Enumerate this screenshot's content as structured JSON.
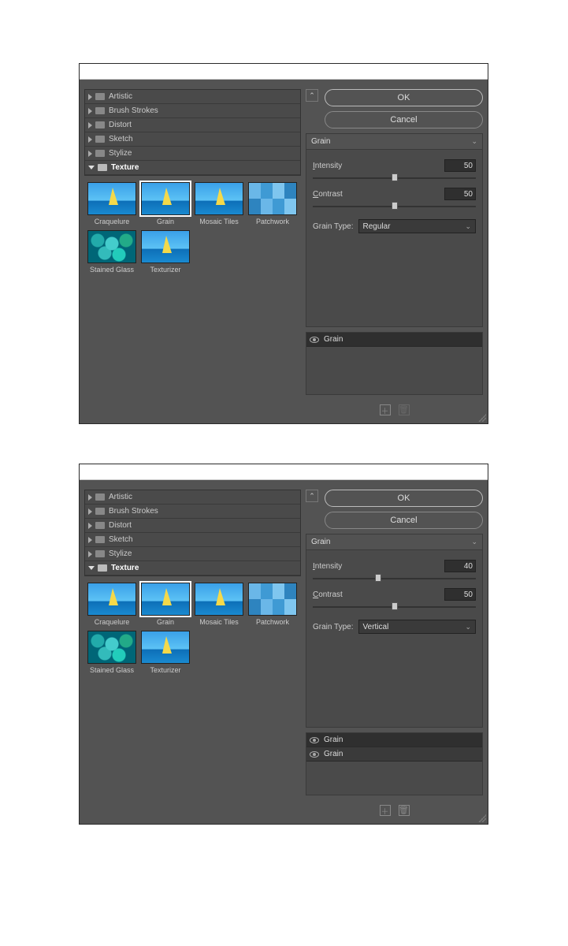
{
  "dialogs": [
    {
      "categories": [
        {
          "label": "Artistic",
          "expanded": false
        },
        {
          "label": "Brush Strokes",
          "expanded": false
        },
        {
          "label": "Distort",
          "expanded": false
        },
        {
          "label": "Sketch",
          "expanded": false
        },
        {
          "label": "Stylize",
          "expanded": false
        },
        {
          "label": "Texture",
          "expanded": true
        }
      ],
      "thumbs": [
        {
          "label": "Craquelure",
          "kind": "boat",
          "selected": false
        },
        {
          "label": "Grain",
          "kind": "boat",
          "selected": true
        },
        {
          "label": "Mosaic Tiles",
          "kind": "boat",
          "selected": false
        },
        {
          "label": "Patchwork",
          "kind": "patch",
          "selected": false
        },
        {
          "label": "Stained Glass",
          "kind": "glass",
          "selected": false
        },
        {
          "label": "Texturizer",
          "kind": "boat",
          "selected": false
        }
      ],
      "buttons": {
        "ok": "OK",
        "cancel": "Cancel"
      },
      "filterName": "Grain",
      "controls": {
        "intensity": {
          "label": "Intensity",
          "underline": "I",
          "value": "50",
          "pct": 50
        },
        "contrast": {
          "label": "Contrast",
          "underline": "C",
          "value": "50",
          "pct": 50
        },
        "grainType": {
          "label": "Grain Type:",
          "value": "Regular"
        }
      },
      "layers": [
        {
          "name": "Grain",
          "selected": true
        }
      ],
      "trashDisabled": true
    },
    {
      "categories": [
        {
          "label": "Artistic",
          "expanded": false
        },
        {
          "label": "Brush Strokes",
          "expanded": false
        },
        {
          "label": "Distort",
          "expanded": false
        },
        {
          "label": "Sketch",
          "expanded": false
        },
        {
          "label": "Stylize",
          "expanded": false
        },
        {
          "label": "Texture",
          "expanded": true
        }
      ],
      "thumbs": [
        {
          "label": "Craquelure",
          "kind": "boat",
          "selected": false
        },
        {
          "label": "Grain",
          "kind": "boat",
          "selected": true
        },
        {
          "label": "Mosaic Tiles",
          "kind": "boat",
          "selected": false
        },
        {
          "label": "Patchwork",
          "kind": "patch",
          "selected": false
        },
        {
          "label": "Stained Glass",
          "kind": "glass",
          "selected": false
        },
        {
          "label": "Texturizer",
          "kind": "boat",
          "selected": false
        }
      ],
      "buttons": {
        "ok": "OK",
        "cancel": "Cancel"
      },
      "filterName": "Grain",
      "controls": {
        "intensity": {
          "label": "Intensity",
          "underline": "I",
          "value": "40",
          "pct": 40
        },
        "contrast": {
          "label": "Contrast",
          "underline": "C",
          "value": "50",
          "pct": 50
        },
        "grainType": {
          "label": "Grain Type:",
          "value": "Vertical"
        }
      },
      "layers": [
        {
          "name": "Grain",
          "selected": true
        },
        {
          "name": "Grain",
          "selected": false
        }
      ],
      "trashDisabled": false
    }
  ]
}
